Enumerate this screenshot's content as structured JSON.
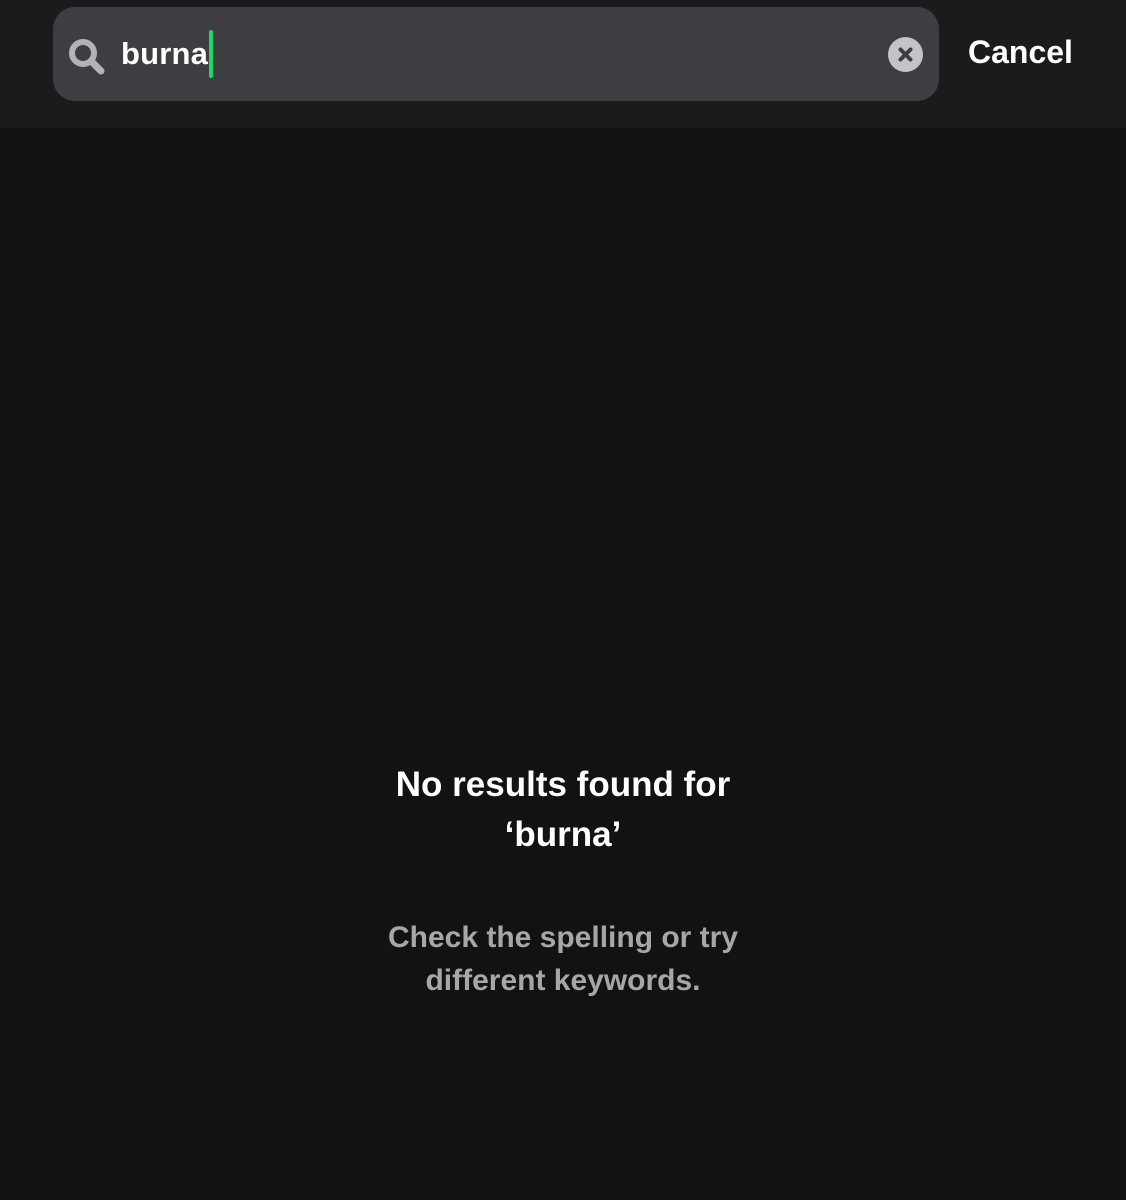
{
  "search": {
    "value": "burna",
    "caret_color": "#1ed760",
    "icon": "search-icon",
    "clear_icon": "close-icon"
  },
  "header": {
    "cancel_label": "Cancel"
  },
  "empty_state": {
    "title_line1": "No results found for",
    "title_line2": "‘burna’",
    "hint_line1": "Check the spelling or try",
    "hint_line2": "different keywords."
  },
  "colors": {
    "background": "#121212",
    "header_background": "#1b1b1c",
    "search_field": "#3e3e42",
    "hint_text": "#a7a7a7",
    "accent": "#1ed760"
  }
}
